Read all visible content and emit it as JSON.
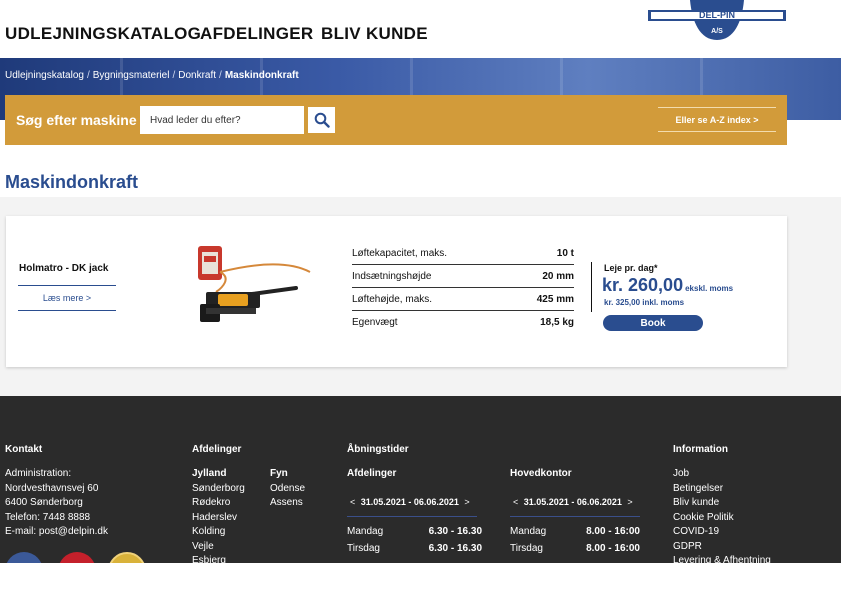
{
  "nav": {
    "catalog": "UDLEJNINGSKATALOG",
    "departments": "AFDELINGER",
    "become_customer": "BLIV KUNDE",
    "logo_text": "DEL-PIN",
    "logo_sub": "A/S"
  },
  "breadcrumb": {
    "items": [
      "Udlejningskatalog",
      "Bygningsmateriel",
      "Donkraft"
    ],
    "current": "Maskindonkraft"
  },
  "search": {
    "label": "Søg efter maskine",
    "placeholder": "Hvad leder du efter?",
    "az_link": "Eller se A-Z index >"
  },
  "page": {
    "title": "Maskindonkraft"
  },
  "product": {
    "name": "Holmatro - DK jack",
    "read_more": "Læs mere  >",
    "specs": [
      {
        "label": "Løftekapacitet, maks.",
        "value": "10 t"
      },
      {
        "label": "Indsætningshøjde",
        "value": "20 mm"
      },
      {
        "label": "Løftehøjde, maks.",
        "value": "425 mm"
      },
      {
        "label": "Egenvægt",
        "value": "18,5 kg"
      }
    ],
    "price_label": "Leje pr. dag*",
    "price": "kr. 260,00",
    "price_suffix": "ekskl. moms",
    "price_inkl": "kr. 325,00 inkl. moms",
    "book": "Book"
  },
  "footer": {
    "contact": {
      "heading": "Kontakt",
      "lines": [
        "Administration:",
        "Nordvesthavnsvej 60",
        "6400 Sønderborg",
        "Telefon: 7448 8888",
        "E-mail: post@delpin.dk"
      ]
    },
    "departments": {
      "heading": "Afdelinger",
      "jylland_heading": "Jylland",
      "jylland": [
        "Sønderborg",
        "Rødekro",
        "Haderslev",
        "Kolding",
        "Vejle",
        "Esbjerg"
      ],
      "fyn_heading": "Fyn",
      "fyn": [
        "Odense",
        "Assens"
      ]
    },
    "opening": {
      "heading": "Åbningstider",
      "departments_heading": "Afdelinger",
      "hq_heading": "Hovedkontor",
      "week": "31.05.2021 - 06.06.2021",
      "week_prev": "<",
      "week_next": ">",
      "departments_hours": [
        {
          "day": "Mandag",
          "time": "6.30 - 16.30"
        },
        {
          "day": "Tirsdag",
          "time": "6.30 - 16.30"
        }
      ],
      "hq_hours": [
        {
          "day": "Mandag",
          "time": "8.00 - 16:00"
        },
        {
          "day": "Tirsdag",
          "time": "8.00 - 16:00"
        }
      ]
    },
    "information": {
      "heading": "Information",
      "links": [
        "Job",
        "Betingelser",
        "Bliv kunde",
        "Cookie Politik",
        "COVID-19",
        "GDPR",
        "Levering & Afhentning"
      ]
    }
  },
  "colors": {
    "brand_blue": "#2a4d8f",
    "search_bar": "#d29b3a",
    "footer_bg": "#2b2b2b"
  }
}
